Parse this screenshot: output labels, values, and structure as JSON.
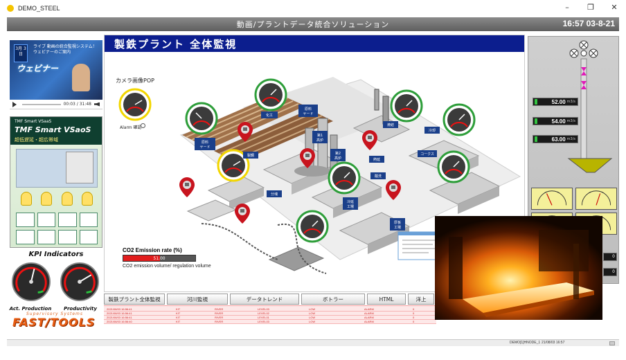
{
  "window": {
    "title": "DEMO_STEEL",
    "minimize": "–",
    "maximize": "❐",
    "close": "✕"
  },
  "header": {
    "title": "動画/プラントデータ統合ソリューション",
    "clock": "16:57 03-8-21"
  },
  "video": {
    "badge": "3月 3日",
    "caption_line1": "ライブ 動画の統合監視システム！",
    "caption_line2": "ウェビナーのご案内",
    "logo": "ウェビナー",
    "time": "00:03 / 31:48"
  },
  "ad": {
    "small": "TMF Smart VSaaS",
    "main": "TMF Smart VSaoS",
    "sub": "超低遅延・超広帯域"
  },
  "kpi": {
    "title": "KPI Indicators",
    "gauge1_label": "Act. Production",
    "gauge2_label": "Productivity",
    "gauge1_level": 0.55,
    "gauge2_level": 0.72
  },
  "brand": {
    "sub": "Supervisory Systems",
    "main": "FAST/TOOLS"
  },
  "main": {
    "title": "製鉄プラント 全体監視",
    "camera_pop_label": "カメラ画像POP",
    "alarm_label": "Alarm 確認"
  },
  "plant_labels": {
    "raw_yard": "原料\nヤード",
    "chemical": "化工",
    "raw_yard2": "原料\nヤード",
    "blast1": "第1\n高炉",
    "blast2": "第2\n高炉",
    "sintering": "焼結",
    "cooler": "冷却",
    "coke": "コークス",
    "hot_rolling": "熱延",
    "steelmaking": "製鋼",
    "blooming": "分塊",
    "pickling": "酸洗",
    "cold_rolling": "冷延\n工場",
    "plate": "厚板\n工場",
    "sinter2": "焼結"
  },
  "co2": {
    "title": "CO2 Emission rate (%)",
    "value": "51.00",
    "fill_fraction": 0.51,
    "subtitle": "CO2 emission volume/ regulation volume"
  },
  "flows": [
    {
      "value": "52.00",
      "unit": "m3/s"
    },
    {
      "value": "54.00",
      "unit": "m3/s"
    },
    {
      "value": "63.00",
      "unit": "m3/s"
    }
  ],
  "right_readouts": [
    "0",
    "0"
  ],
  "tabs": [
    "製鉄プラント全体監視",
    "河川監視",
    "データトレンド",
    "ボトラー",
    "HTML",
    "洋上"
  ],
  "alarms": [
    {
      "date": "2021/08/03 16:56:41",
      "tag": "KIT",
      "area": "RIVER",
      "item": "LEVEL03",
      "level": "LOW",
      "state": "ALARM",
      "code": "0"
    },
    {
      "date": "2021/08/03 16:56:41",
      "tag": "KIT",
      "area": "RIVER",
      "item": "LEVEL02",
      "level": "LOW",
      "state": "ALARM",
      "code": "0"
    },
    {
      "date": "2021/08/03 16:56:41",
      "tag": "KIT",
      "area": "RIVER",
      "item": "LEVEL01",
      "level": "LOW",
      "state": "ALARM",
      "code": "0"
    },
    {
      "date": "2021/08/03 16:56:40",
      "tag": "KIT",
      "area": "RIVER",
      "item": "LEVEL03",
      "level": "LOW",
      "state": "ALARM",
      "code": "0"
    }
  ],
  "status": {
    "node": "DEMO[1]HNODE_1",
    "datetime": "21/08/03 16:57"
  },
  "colors": {
    "title_bar": "#0c1e8e",
    "alarm_text": "#d21c1c",
    "ring_green": "#2e9e3a",
    "ring_yellow": "#f2d600",
    "pin_red": "#c8141e",
    "label_blue": "#1a3f8a",
    "brand_orange": "#e85d12"
  }
}
